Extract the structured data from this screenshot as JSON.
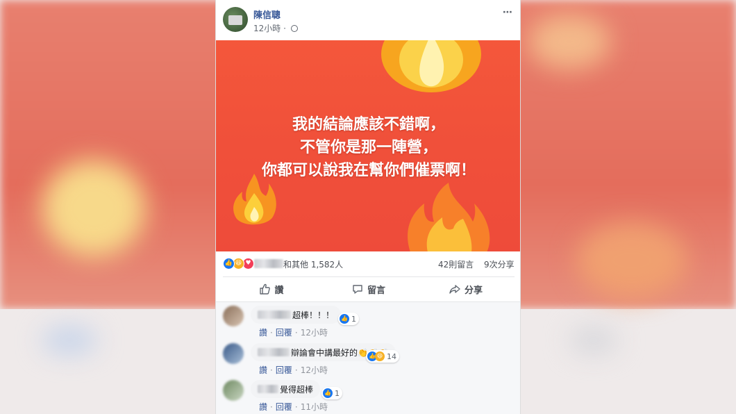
{
  "post": {
    "author": "陳信聰",
    "time": "12小時",
    "more_icon": "⋯",
    "image_text": [
      "我的結論應該不錯啊，",
      "不管你是那一陣營，",
      "你都可以說我在幫你們催票啊！"
    ]
  },
  "reactions": {
    "icons": [
      "like-icon",
      "haha-icon",
      "love-icon"
    ],
    "summary": "和其他 1,582人",
    "comments": "42則留言",
    "shares": "9次分享"
  },
  "actions": {
    "like": "讚",
    "comment": "留言",
    "share": "分享"
  },
  "comments": [
    {
      "text": "超棒！！！",
      "reaction_count": "1",
      "like": "讚",
      "reply": "回覆",
      "time": "12小時"
    },
    {
      "text": "辯論會中講最好的👏👏👏",
      "reaction_count": "14",
      "like": "讚",
      "reply": "回覆",
      "time": "12小時"
    },
    {
      "text": "覺得超棒",
      "reaction_count": "1",
      "like": "讚",
      "reply": "回覆",
      "time": "11小時"
    }
  ],
  "colors": {
    "image_bg": "#f0503a",
    "link": "#385898",
    "like_blue": "#1877f2",
    "love_red": "#f33e58",
    "haha_yellow": "#f7b125"
  }
}
